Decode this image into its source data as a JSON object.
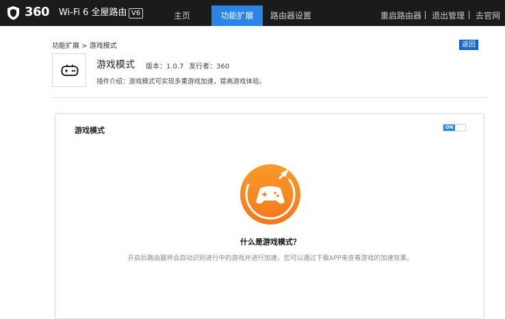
{
  "topbar": {
    "logo_mark": "360",
    "logo_name": "Wi-Fi 6 全屋路由",
    "logo_badge": "V6",
    "nav": [
      {
        "label": "主页"
      },
      {
        "label": "功能扩展"
      },
      {
        "label": "路由器设置"
      }
    ],
    "right_links": [
      {
        "label": "重启路由器"
      },
      {
        "label": "退出管理"
      },
      {
        "label": "去官网"
      }
    ]
  },
  "breadcrumb": "功能扩展 > 游戏模式",
  "back_label": "返回",
  "plugin": {
    "icon": "gamepad-icon",
    "title": "游戏模式",
    "version": "版本：1.0.7",
    "publisher": "发行者：360",
    "intro": "插件介绍：游戏模式可实现多重游戏加速，提高游戏体验。"
  },
  "card": {
    "title": "游戏模式",
    "toggle_label": "ON",
    "illustration": "game-rocket-icon",
    "question": "什么是游戏模式？",
    "description": "开启后路由器将会自动识别进行中的游戏并进行加速，您可以通过下载APP来查看游戏的加速效果。"
  },
  "colors": {
    "topbar_bg": "#1b1b1b",
    "accent_blue": "#2b84e6",
    "orange": "#f5871f"
  }
}
